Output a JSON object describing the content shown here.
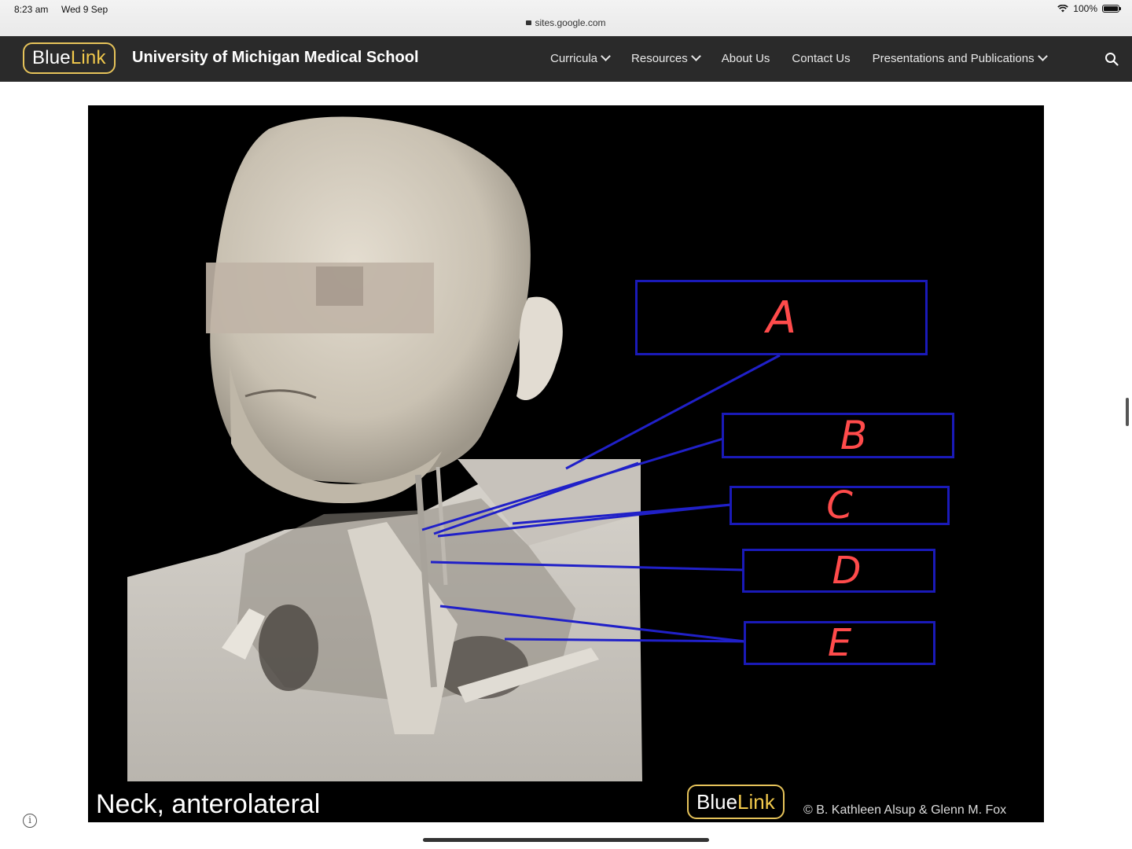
{
  "status_bar": {
    "time": "8:23 am",
    "date": "Wed 9 Sep",
    "url": "sites.google.com",
    "battery": "100%"
  },
  "header": {
    "logo_blue": "Blue",
    "logo_link": "Link",
    "title": "University of Michigan Medical School",
    "nav": [
      {
        "label": "Curricula",
        "dropdown": true
      },
      {
        "label": "Resources",
        "dropdown": true
      },
      {
        "label": "About Us",
        "dropdown": false
      },
      {
        "label": "Contact Us",
        "dropdown": false
      },
      {
        "label": "Presentations and Publications",
        "dropdown": true
      }
    ]
  },
  "figure": {
    "caption": "Neck, anterolateral",
    "logo_blue": "Blue",
    "logo_link": "Link",
    "copyright": "© B. Kathleen Alsup & Glenn M. Fox",
    "labels": [
      "A",
      "B",
      "C",
      "D",
      "E"
    ],
    "colors": {
      "box": "#1a1ab8",
      "letter": "#ff4b4b",
      "leader": "#2020c8"
    }
  }
}
